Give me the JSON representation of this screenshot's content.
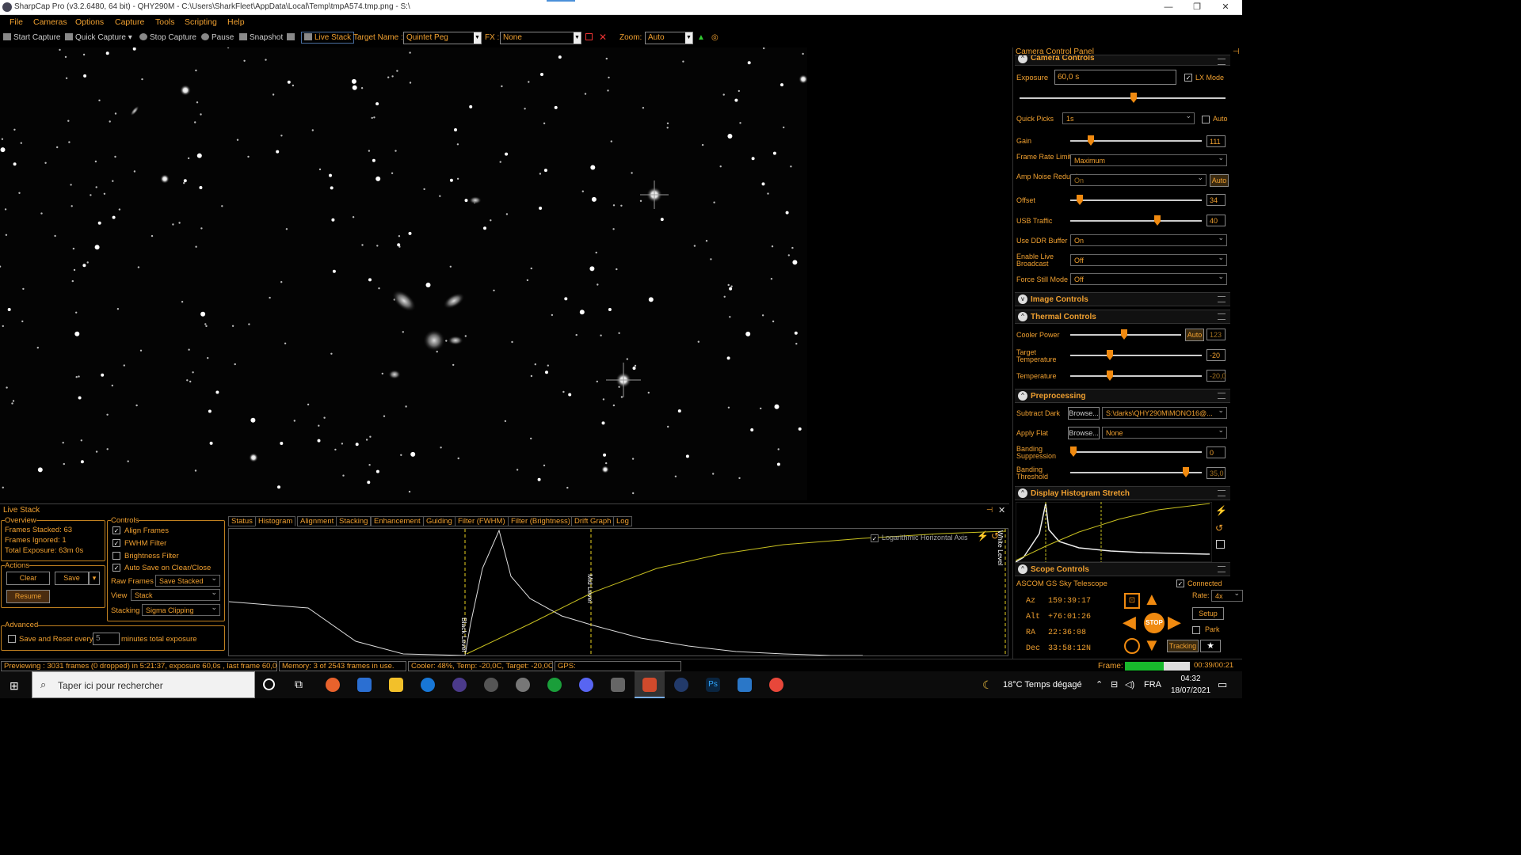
{
  "window": {
    "title": "SharpCap Pro (v3.2.6480, 64 bit) - QHY290M - C:\\Users\\SharkFleet\\AppData\\Local\\Temp\\tmpA574.tmp.png - S:\\"
  },
  "menu": [
    "File",
    "Cameras",
    "Options",
    "Capture",
    "Tools",
    "Scripting",
    "Help"
  ],
  "toolbar": {
    "start_capture": "Start Capture",
    "quick_capture": "Quick Capture",
    "stop_capture": "Stop Capture",
    "pause": "Pause",
    "snapshot": "Snapshot",
    "live_stack": "Live Stack",
    "target_name_label": "Target Name :",
    "target_name_value": "Quintet Peg",
    "fx_label": "FX :",
    "fx_value": "None",
    "zoom_label": "Zoom:",
    "zoom_value": "Auto"
  },
  "panel": {
    "title": "Camera Control Panel",
    "camera_controls": {
      "header": "Camera Controls",
      "exposure_label": "Exposure",
      "exposure_value": "60,0 s",
      "lx_mode": "LX Mode",
      "quick_picks_label": "Quick Picks",
      "quick_picks_value": "1s",
      "auto": "Auto",
      "gain_label": "Gain",
      "gain_value": "111",
      "frame_rate_label": "Frame Rate Limit",
      "frame_rate_value": "Maximum",
      "amp_noise_label": "Amp Noise Reduction",
      "amp_noise_value": "On",
      "amp_noise_auto": "Auto",
      "offset_label": "Offset",
      "offset_value": "34",
      "usb_label": "USB Traffic",
      "usb_value": "40",
      "ddr_label": "Use DDR Buffer",
      "ddr_value": "On",
      "live_broadcast_label": "Enable Live Broadcast",
      "live_broadcast_value": "Off",
      "force_still_label": "Force Still Mode",
      "force_still_value": "Off"
    },
    "image_controls": {
      "header": "Image Controls"
    },
    "thermal": {
      "header": "Thermal Controls",
      "cooler_label": "Cooler Power",
      "cooler_auto": "Auto",
      "cooler_value": "123",
      "target_label": "Target Temperature",
      "target_value": "-20",
      "temp_label": "Temperature",
      "temp_value": "-20,0"
    },
    "preprocessing": {
      "header": "Preprocessing",
      "dark_label": "Subtract Dark",
      "browse": "Browse...",
      "dark_value": "S:\\darks\\QHY290M\\MONO16@...",
      "flat_label": "Apply Flat",
      "flat_value": "None",
      "banding_supp_label": "Banding Suppression",
      "banding_supp_value": "0",
      "banding_thr_label": "Banding Threshold",
      "banding_thr_value": "35,0"
    },
    "histogram": {
      "header": "Display Histogram Stretch"
    },
    "scope": {
      "header": "Scope Controls",
      "name": "ASCOM GS Sky Telescope",
      "connected": "Connected",
      "az_label": "Az",
      "az_value": "159:39:17",
      "alt_label": "Alt",
      "alt_value": "+76:01:26",
      "ra_label": "RA",
      "ra_value": "22:36:08",
      "dec_label": "Dec",
      "dec_value": "33:58:12N",
      "rate_label": "Rate:",
      "rate_value": "4x",
      "setup": "Setup",
      "park": "Park",
      "stop": "STOP",
      "tracking": "Tracking"
    }
  },
  "livestack": {
    "title": "Live Stack",
    "overview": {
      "label": "Overview",
      "frames_stacked": "Frames Stacked:  63",
      "frames_ignored": "Frames Ignored:   1",
      "total_exposure": "Total Exposure:   63m 0s"
    },
    "actions": {
      "label": "Actions",
      "clear": "Clear",
      "save": "Save",
      "resume": "Resume"
    },
    "advanced": {
      "label": "Advanced",
      "save_reset": "Save and Reset every",
      "minutes_value": "5",
      "minutes_label": "minutes total exposure"
    },
    "controls": {
      "label": "Controls",
      "align": "Align Frames",
      "fwhm": "FWHM Filter",
      "brightness": "Brightness Filter",
      "autosave": "Auto Save on Clear/Close",
      "raw_frames_label": "Raw Frames",
      "raw_frames_value": "Save Stacked",
      "view_label": "View",
      "view_value": "Stack",
      "stacking_label": "Stacking",
      "stacking_value": "Sigma Clipping"
    },
    "tabs": [
      "Status",
      "Histogram",
      "Alignment",
      "Stacking",
      "Enhancement",
      "Guiding",
      "Filter (FWHM)",
      "Filter (Brightness)",
      "Drift Graph",
      "Log"
    ],
    "hist": {
      "log_axis": "Logarithmic Horizontal Axis",
      "black_level": "Black Level",
      "mid_level": "Mid Level",
      "white_level": "White Level"
    }
  },
  "status": {
    "preview": "Previewing : 3031 frames (0 dropped) in 5:21:37, exposure 60,0s , last frame 60,0s",
    "memory": "Memory: 3 of 2543 frames in use.",
    "cooler": "Cooler: 48%, Temp: -20,0C, Target: -20,0C",
    "gps": "GPS:",
    "frame_label": "Frame:",
    "frame_time": "00:39/00:21"
  },
  "taskbar": {
    "search": "Taper ici pour rechercher",
    "weather": "18°C  Temps dégagé",
    "lang": "FRA",
    "time": "04:32",
    "date": "18/07/2021"
  }
}
